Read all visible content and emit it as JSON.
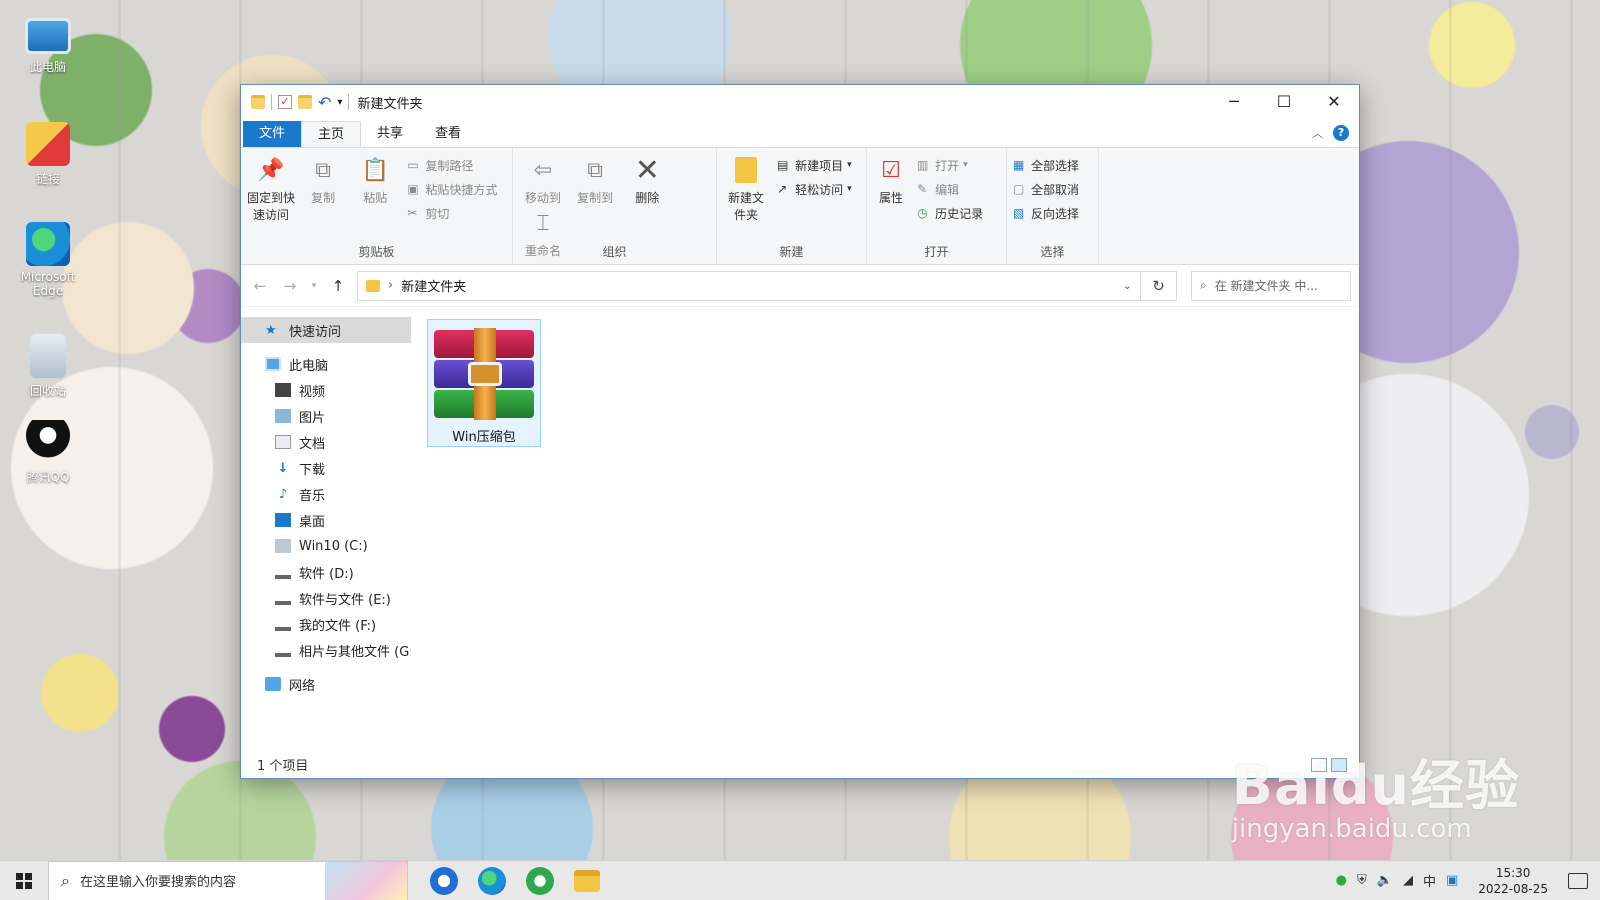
{
  "desktop": {
    "icons": [
      {
        "label": "此电脑",
        "icon": "computer-icon"
      },
      {
        "label": "链接",
        "icon": "link-folder-icon"
      },
      {
        "label": "Microsoft Edge",
        "icon": "edge-icon"
      },
      {
        "label": "回收站",
        "icon": "recycle-bin-icon"
      },
      {
        "label": "腾讯QQ",
        "icon": "qq-icon"
      }
    ]
  },
  "window": {
    "title": "新建文件夹",
    "controls": {
      "minimize": "─",
      "maximize": "☐",
      "close": "✕"
    },
    "tabs": {
      "file": "文件",
      "home": "主页",
      "share": "共享",
      "view": "查看"
    },
    "ribbon": {
      "clipboard": {
        "label": "剪贴板",
        "pin": "固定到快速访问",
        "copy": "复制",
        "paste": "粘贴",
        "copy_path": "复制路径",
        "paste_shortcut": "粘贴快捷方式",
        "cut": "剪切"
      },
      "organize": {
        "label": "组织",
        "move_to": "移动到",
        "copy_to": "复制到",
        "delete": "删除",
        "rename": "重命名"
      },
      "new": {
        "label": "新建",
        "new_folder": "新建文件夹",
        "new_item": "新建项目",
        "easy_access": "轻松访问"
      },
      "open": {
        "label": "打开",
        "properties": "属性",
        "open": "打开",
        "edit": "编辑",
        "history": "历史记录"
      },
      "select": {
        "label": "选择",
        "select_all": "全部选择",
        "select_none": "全部取消",
        "invert": "反向选择"
      }
    },
    "address": {
      "path": "新建文件夹",
      "separator": "›",
      "search_placeholder": "在 新建文件夹 中..."
    },
    "nav": {
      "quick_access": "快速访问",
      "this_pc": "此电脑",
      "items": [
        "视频",
        "图片",
        "文档",
        "下载",
        "音乐",
        "桌面",
        "Win10 (C:)",
        "软件 (D:)",
        "软件与文件 (E:)",
        "我的文件 (F:)",
        "相片与其他文件 (G:"
      ],
      "network": "网络"
    },
    "files": [
      {
        "name": "Win压缩包",
        "icon": "winrar-archive-icon"
      }
    ],
    "status": {
      "item_count": "1 个项目"
    }
  },
  "taskbar": {
    "search_placeholder": "在这里输入你要搜索的内容",
    "time": "15:30",
    "date": "2022-08-25"
  },
  "watermark": {
    "main": "Baidu经验",
    "url": "jingyan.baidu.com"
  }
}
